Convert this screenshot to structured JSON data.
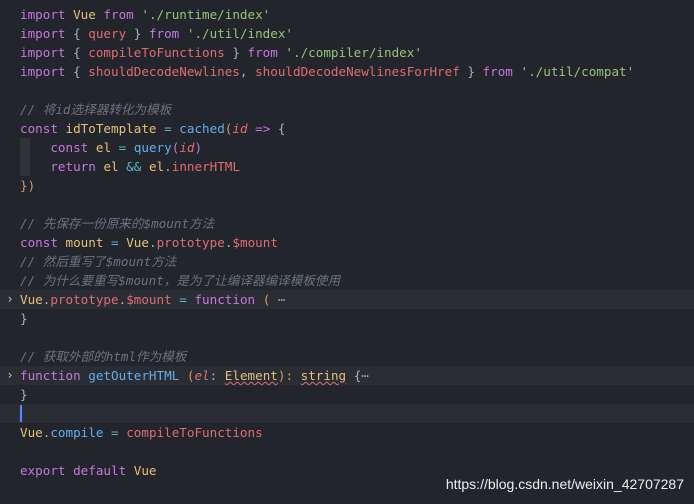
{
  "code": {
    "l1": [
      "import",
      " Vue ",
      "from",
      " ",
      "'./runtime/index'"
    ],
    "l2": [
      "import",
      " { ",
      "query",
      " } ",
      "from",
      " ",
      "'./util/index'"
    ],
    "l3": [
      "import",
      " { ",
      "compileToFunctions",
      " } ",
      "from",
      " ",
      "'./compiler/index'"
    ],
    "l4": [
      "import",
      " { ",
      "shouldDecodeNewlines",
      ", ",
      "shouldDecodeNewlinesForHref",
      " } ",
      "from",
      " ",
      "'./util/compat'"
    ],
    "l6": "// 将id选择器转化为模板",
    "l7": [
      "const",
      " ",
      "idToTemplate",
      " ",
      "=",
      " ",
      "cached",
      "(",
      "id",
      " ",
      "=>",
      " {"
    ],
    "l8": [
      "const",
      " ",
      "el",
      " ",
      "=",
      " ",
      "query",
      "(",
      "id",
      ")"
    ],
    "l9": [
      "return",
      " ",
      "el",
      " ",
      "&&",
      " ",
      "el",
      ".",
      "innerHTML"
    ],
    "l10": "})",
    "l12": "// 先保存一份原来的$mount方法",
    "l13": [
      "const",
      " ",
      "mount",
      " ",
      "=",
      " ",
      "Vue",
      ".",
      "prototype",
      ".",
      "$mount"
    ],
    "l14": "// 然后重写了$mount方法",
    "l15": "// 为什么要重写$mount，是为了让编译器编译模板使用",
    "l16": [
      "Vue",
      ".",
      "prototype",
      ".",
      "$mount",
      " ",
      "=",
      " ",
      "function",
      " ",
      "(",
      " ",
      "⋯"
    ],
    "l17": "}",
    "l19": "// 获取外部的html作为模板",
    "l20": [
      "function",
      " ",
      "getOuterHTML",
      " ",
      "(",
      "el",
      ": ",
      "Element",
      "): ",
      "string",
      " {",
      "⋯"
    ],
    "l21": "}",
    "l23": [
      "Vue",
      ".",
      "compile",
      " ",
      "=",
      " ",
      "compileToFunctions"
    ],
    "l25": [
      "export",
      " ",
      "default",
      " ",
      "Vue"
    ]
  },
  "watermark": "https://blog.csdn.net/weixin_42707287",
  "icons": {
    "fold": "chevron-right-icon"
  }
}
